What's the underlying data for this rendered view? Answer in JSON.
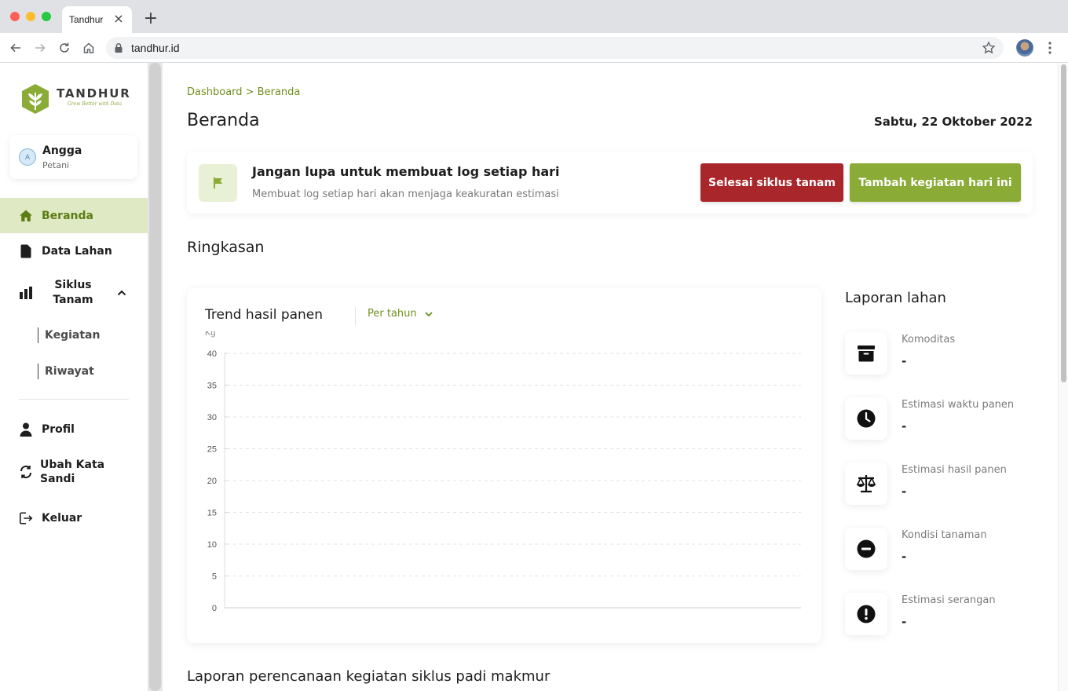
{
  "browser": {
    "tab_title": "Tandhur",
    "url": "tandhur.id"
  },
  "sidebar": {
    "logo_name": "TANDHUR",
    "logo_tagline": "Grow Better with Data",
    "user": {
      "initial": "A",
      "name": "Angga",
      "role": "Petani"
    },
    "items": [
      {
        "label": "Beranda",
        "icon": "home-icon",
        "active": true
      },
      {
        "label": "Data Lahan",
        "icon": "file-icon",
        "active": false
      },
      {
        "label": "Siklus Tanam",
        "icon": "bar-chart-icon",
        "active": false,
        "expanded": true
      }
    ],
    "sub_items": [
      {
        "label": "Kegiatan"
      },
      {
        "label": "Riwayat"
      }
    ],
    "bottom_items": [
      {
        "label": "Profil",
        "icon": "person-icon"
      },
      {
        "label": "Ubah Kata Sandi",
        "icon": "sync-icon"
      },
      {
        "label": "Keluar",
        "icon": "logout-icon"
      }
    ]
  },
  "main": {
    "breadcrumb": "Dashboard > Beranda",
    "title": "Beranda",
    "date": "Sabtu, 22 Oktober 2022",
    "banner": {
      "title": "Jangan lupa untuk membuat log setiap hari",
      "subtitle": "Membuat log setiap hari akan menjaga keakuratan estimasi",
      "finish_button": "Selesai siklus tanam",
      "add_button": "Tambah kegiatan hari ini"
    },
    "summary_title": "Ringkasan",
    "chart_card": {
      "title": "Trend hasil panen",
      "period_selected": "Per tahun"
    },
    "report": {
      "title": "Laporan lahan",
      "items": [
        {
          "label": "Komoditas",
          "value": "-",
          "icon": "archive-box-icon"
        },
        {
          "label": "Estimasi waktu panen",
          "value": "-",
          "icon": "clock-icon"
        },
        {
          "label": "Estimasi hasil panen",
          "value": "-",
          "icon": "scale-icon"
        },
        {
          "label": "Kondisi tanaman",
          "value": "-",
          "icon": "minus-circle-icon"
        },
        {
          "label": "Estimasi serangan",
          "value": "-",
          "icon": "exclamation-circle-icon"
        }
      ]
    },
    "bottom_section_title": "Laporan perencanaan kegiatan siklus padi makmur"
  },
  "colors": {
    "brand_green": "#8aab36",
    "brand_green_dark": "#6f8f1e",
    "active_bg": "#dfe9c4",
    "danger": "#a9262a"
  },
  "chart_data": {
    "type": "line",
    "title": "Trend hasil panen",
    "ylabel": "Kg",
    "xlabel": "",
    "ylim": [
      0,
      40
    ],
    "y_ticks": [
      0,
      5,
      10,
      15,
      20,
      25,
      30,
      35,
      40
    ],
    "x": [],
    "series": [],
    "grid": true
  }
}
